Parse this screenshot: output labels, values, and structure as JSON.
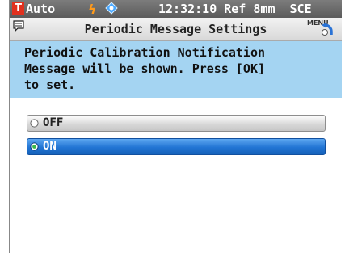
{
  "status": {
    "mode": "Auto",
    "mode_badge": "T",
    "flash_icon": "flash-icon",
    "target_icon": "target-icon",
    "readout": "12:32:10 Ref 8mm  SCE"
  },
  "title_bar": {
    "title": "Periodic Message Settings",
    "menu_label": "MENU"
  },
  "info": {
    "text": "Periodic Calibration Notification\nMessage will be shown. Press [OK]\nto set."
  },
  "options": [
    {
      "label": "OFF",
      "selected": false
    },
    {
      "label": "ON",
      "selected": true
    }
  ],
  "colors": {
    "status_bg": "#6a6a6a",
    "info_bg": "#a4d4f2",
    "selected_bg": "#2275d4",
    "badge": "#e0301e",
    "flash": "#ff9a1a"
  }
}
